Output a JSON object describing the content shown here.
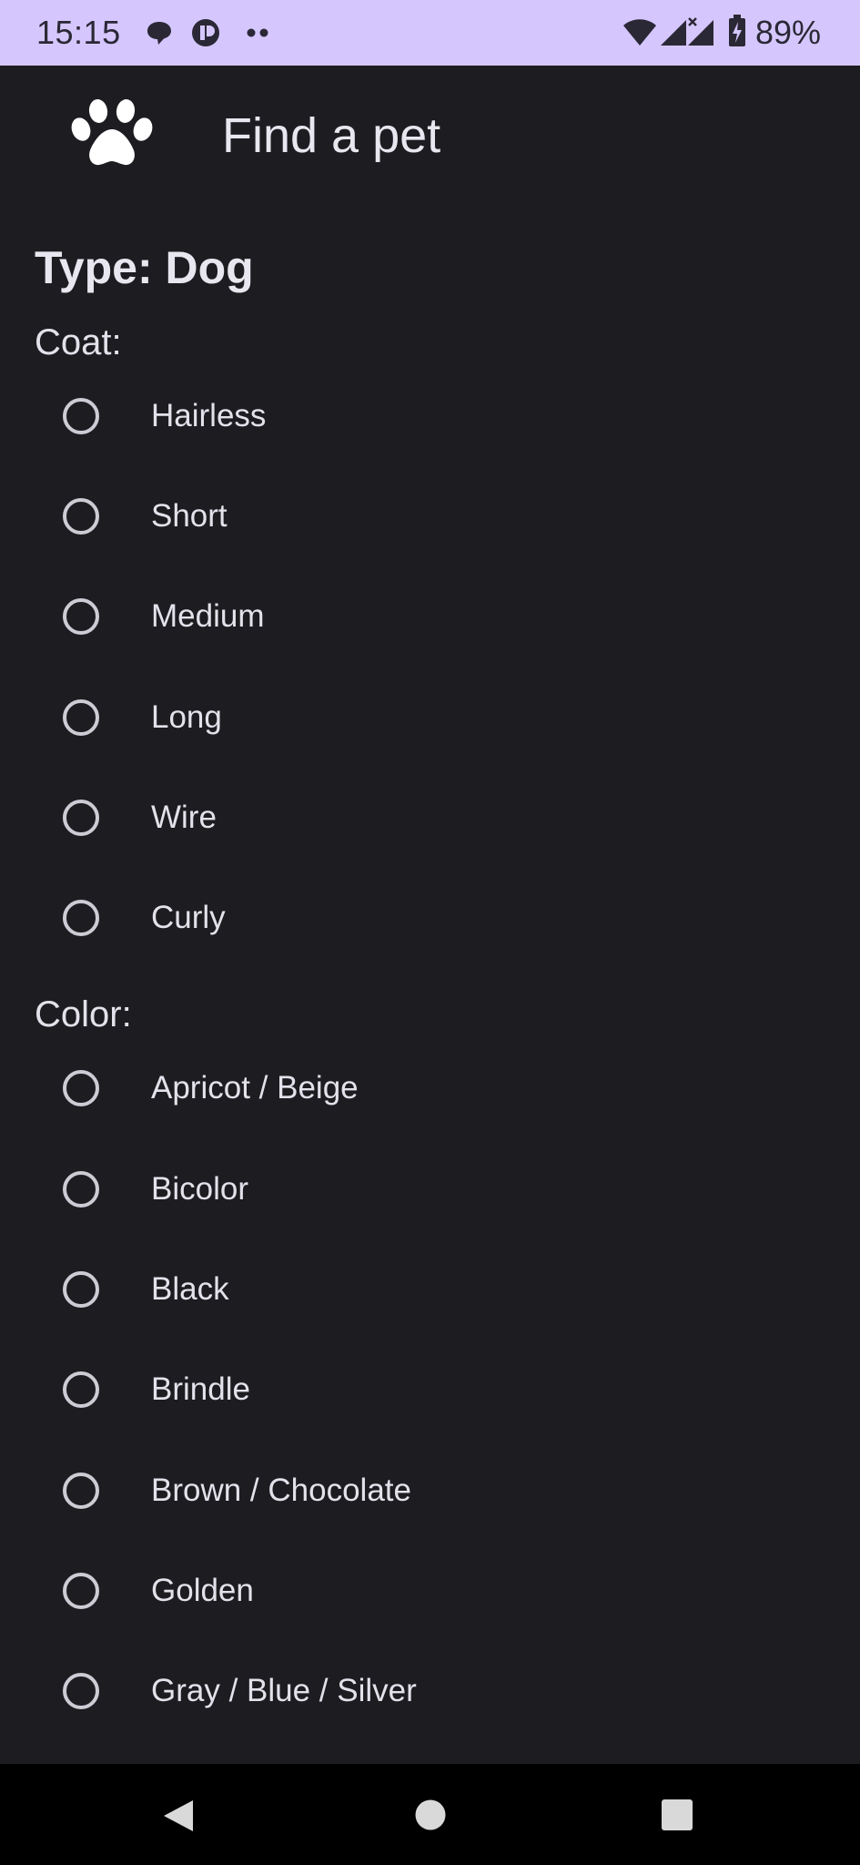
{
  "status_bar": {
    "time": "15:15",
    "battery_percent": "89%",
    "icons": [
      "chat-bubble-icon",
      "app-badge-icon",
      "more-dots-icon",
      "wifi-icon",
      "signal-icon",
      "battery-icon"
    ]
  },
  "app_bar": {
    "title": "Find a pet",
    "icon": "paw-icon"
  },
  "type_heading": "Type: Dog",
  "coat": {
    "label": "Coat:",
    "options": [
      {
        "label": "Hairless",
        "selected": false
      },
      {
        "label": "Short",
        "selected": false
      },
      {
        "label": "Medium",
        "selected": false
      },
      {
        "label": "Long",
        "selected": false
      },
      {
        "label": "Wire",
        "selected": false
      },
      {
        "label": "Curly",
        "selected": false
      }
    ]
  },
  "color": {
    "label": "Color:",
    "options": [
      {
        "label": "Apricot / Beige",
        "selected": false
      },
      {
        "label": "Bicolor",
        "selected": false
      },
      {
        "label": "Black",
        "selected": false
      },
      {
        "label": "Brindle",
        "selected": false
      },
      {
        "label": "Brown / Chocolate",
        "selected": false
      },
      {
        "label": "Golden",
        "selected": false
      },
      {
        "label": "Gray / Blue / Silver",
        "selected": false
      }
    ]
  },
  "nav_bar": {
    "buttons": [
      "back-icon",
      "home-icon",
      "recents-icon"
    ]
  },
  "colors": {
    "status_bar_bg": "#d5c7fe",
    "background": "#1d1c21",
    "text": "#e3e1ea",
    "radio_outline": "#cdcbd4"
  }
}
